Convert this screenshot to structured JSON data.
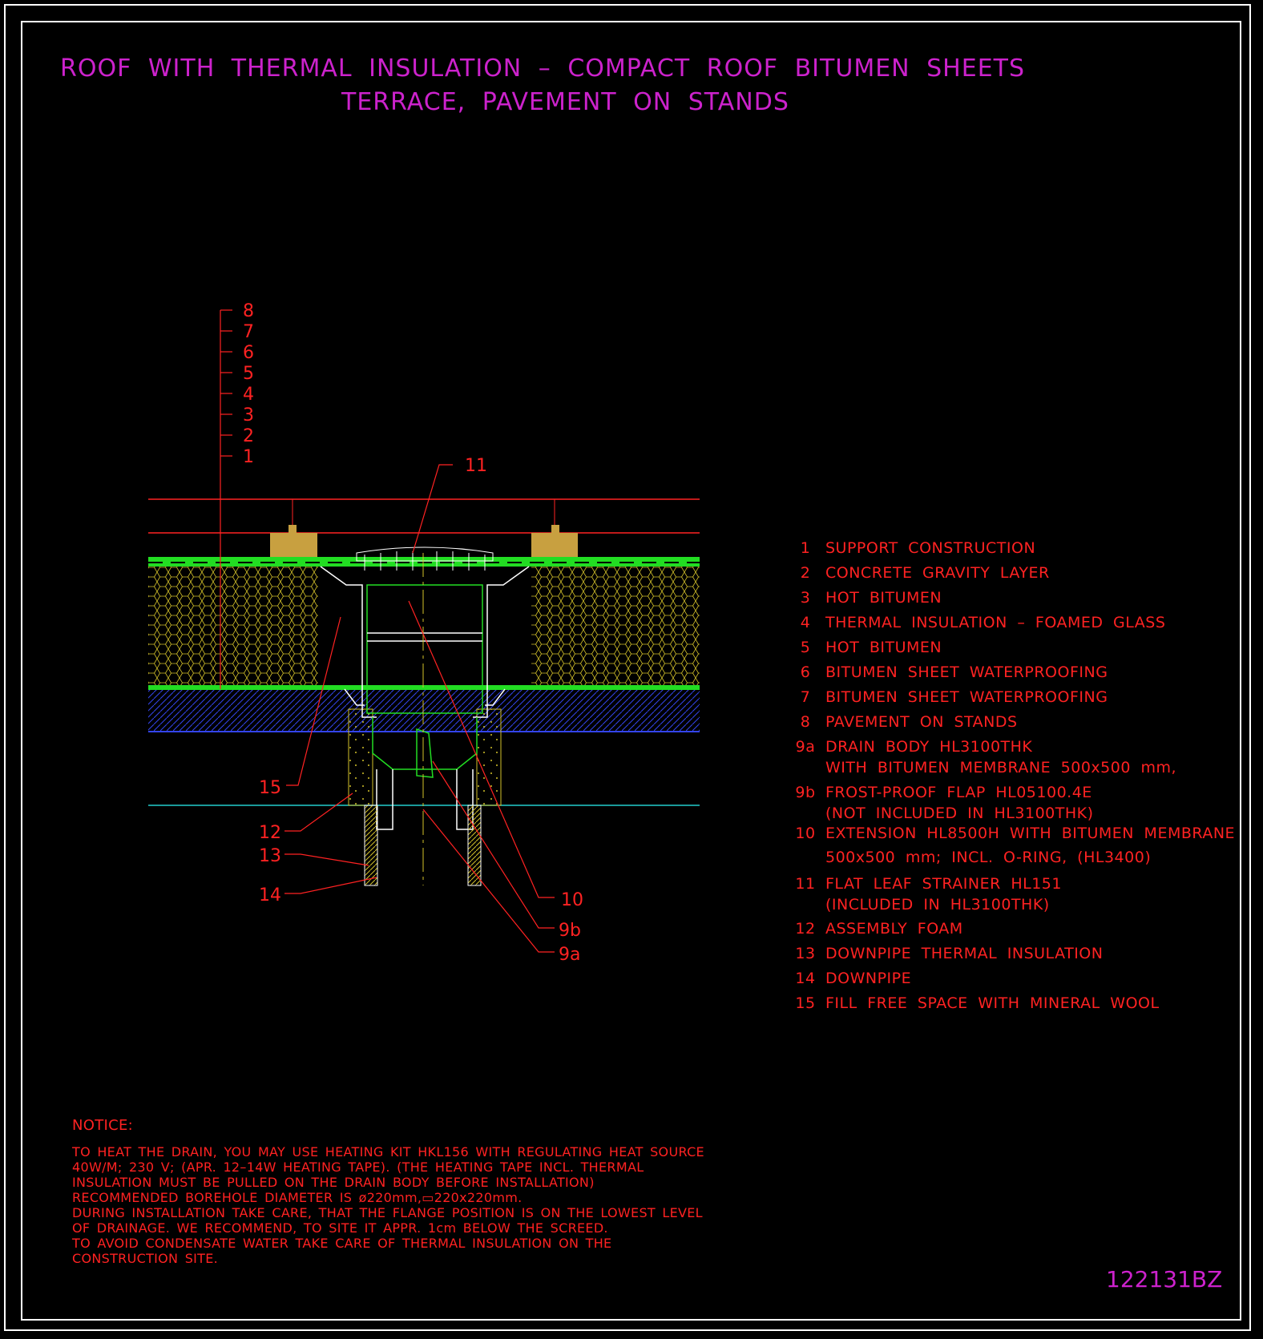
{
  "title": {
    "line1": "ROOF WITH THERMAL INSULATION – COMPACT ROOF BITUMEN SHEETS",
    "line2": "TERRACE, PAVEMENT ON STANDS"
  },
  "layer_labels": [
    "8",
    "7",
    "6",
    "5",
    "4",
    "3",
    "2",
    "1"
  ],
  "callouts": {
    "c11": "11",
    "c15": "15",
    "c12": "12",
    "c13": "13",
    "c14": "14",
    "c10": "10",
    "c9b": "9b",
    "c9a": "9a"
  },
  "legend": [
    {
      "num": "1",
      "text": "SUPPORT CONSTRUCTION"
    },
    {
      "num": "2",
      "text": "CONCRETE GRAVITY LAYER"
    },
    {
      "num": "3",
      "text": "HOT BITUMEN"
    },
    {
      "num": "4",
      "text": "THERMAL INSULATION – FOAMED GLASS"
    },
    {
      "num": "5",
      "text": "HOT BITUMEN"
    },
    {
      "num": "6",
      "text": "BITUMEN SHEET WATERPROOFING"
    },
    {
      "num": "7",
      "text": "BITUMEN SHEET WATERPROOFING"
    },
    {
      "num": "8",
      "text": "PAVEMENT ON STANDS"
    },
    {
      "num": "9a",
      "text": "DRAIN BODY HL3100THK",
      "text2": "WITH BITUMEN MEMBRANE 500x500 mm,"
    },
    {
      "num": "9b",
      "text": "FROST-PROOF FLAP HL05100.4E",
      "text2": "(NOT INCLUDED IN HL3100THK)"
    },
    {
      "num": "10",
      "text": "EXTENSION HL8500H WITH BITUMEN MEMBRANE",
      "text2": "500x500 mm; INCL. O-RING, (HL3400)"
    },
    {
      "num": "11",
      "text": "FLAT LEAF STRAINER HL151",
      "text2": "(INCLUDED IN HL3100THK)"
    },
    {
      "num": "12",
      "text": "ASSEMBLY FOAM"
    },
    {
      "num": "13",
      "text": "DOWNPIPE THERMAL INSULATION"
    },
    {
      "num": "14",
      "text": "DOWNPIPE"
    },
    {
      "num": "15",
      "text": "FILL FREE SPACE WITH MINERAL WOOL"
    }
  ],
  "notice": {
    "title": "NOTICE:",
    "lines": [
      "TO HEAT THE DRAIN, YOU MAY USE HEATING KIT HKL156 WITH REGULATING HEAT SOURCE",
      "40W/M; 230 V;  (APR. 12–14W HEATING TAPE). (THE HEATING TAPE INCL. THERMAL",
      "INSULATION MUST BE PULLED ON THE DRAIN BODY BEFORE INSTALLATION)",
      "RECOMMENDED BOREHOLE DIAMETER IS ø220mm,▭220x220mm.",
      "DURING INSTALLATION TAKE CARE, THAT THE FLANGE POSITION IS ON THE LOWEST LEVEL",
      "OF DRAINAGE. WE RECOMMEND, TO SITE IT APPR. 1cm BELOW THE SCREED.",
      "TO AVOID CONDENSATE WATER TAKE CARE OF THERMAL INSULATION ON THE",
      "CONSTRUCTION SITE."
    ]
  },
  "drawing_id": "122131BZ",
  "colors": {
    "background": "#000000",
    "frame": "#ffffff",
    "title": "#cc22cc",
    "labels": "#ff2222",
    "insulation": "#d4c22a",
    "membrane": "#22dd22",
    "concrete": "#3344ee",
    "stand": "#c8a040",
    "drain": "#ffffff",
    "cyan": "#22cccc"
  }
}
